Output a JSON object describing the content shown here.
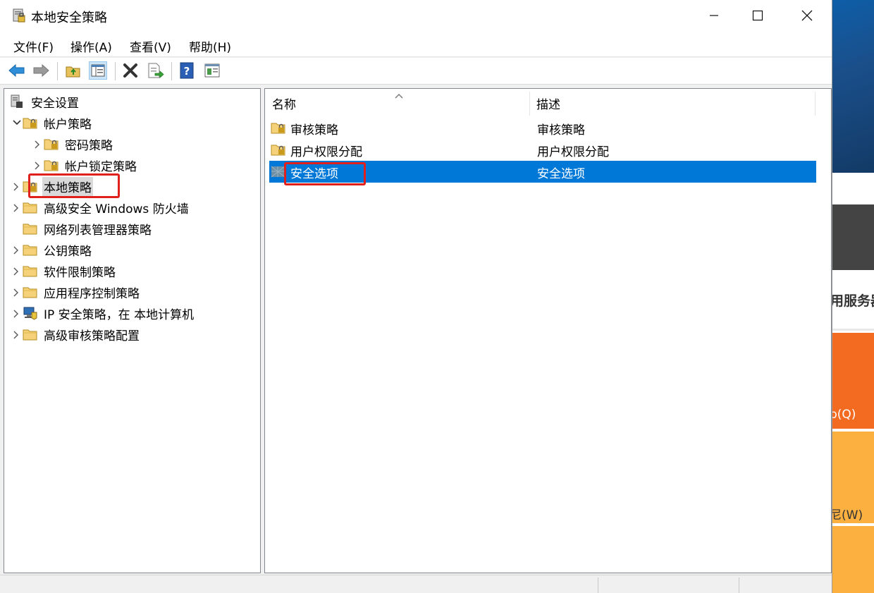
{
  "window": {
    "title": "本地安全策略",
    "minimize": "minimize",
    "maximize": "maximize",
    "close": "close"
  },
  "menu": [
    "文件(F)",
    "操作(A)",
    "查看(V)",
    "帮助(H)"
  ],
  "toolbar": [
    "back-arrow-icon",
    "forward-arrow-icon",
    "up-folder-icon",
    "show-hide-tree-icon",
    "delete-icon",
    "export-list-icon",
    "help-icon",
    "properties-icon"
  ],
  "tree": {
    "root": "安全设置",
    "items": [
      {
        "label": "帐户策略",
        "expanded": true
      },
      {
        "label": "密码策略"
      },
      {
        "label": "帐户锁定策略"
      },
      {
        "label": "本地策略",
        "selected": true
      },
      {
        "label": "高级安全 Windows 防火墙"
      },
      {
        "label": "网络列表管理器策略"
      },
      {
        "label": "公钥策略"
      },
      {
        "label": "软件限制策略"
      },
      {
        "label": "应用程序控制策略"
      },
      {
        "label": "IP 安全策略，在 本地计算机"
      },
      {
        "label": "高级审核策略配置"
      }
    ]
  },
  "list": {
    "columns": [
      "名称",
      "描述"
    ],
    "rows": [
      {
        "name": "审核策略",
        "desc": "审核策略"
      },
      {
        "name": "用户权限分配",
        "desc": "用户权限分配"
      },
      {
        "name": "安全选项",
        "desc": "安全选项",
        "selected": true
      }
    ]
  },
  "background": {
    "text1": "用服务器",
    "text2": "b(Q)",
    "text3": "尼(W)"
  },
  "colors": {
    "selection": "#0078d7",
    "highlight_box": "#e0201c",
    "accent_orange": "#f26b21",
    "accent_yellow": "#fbb040"
  }
}
